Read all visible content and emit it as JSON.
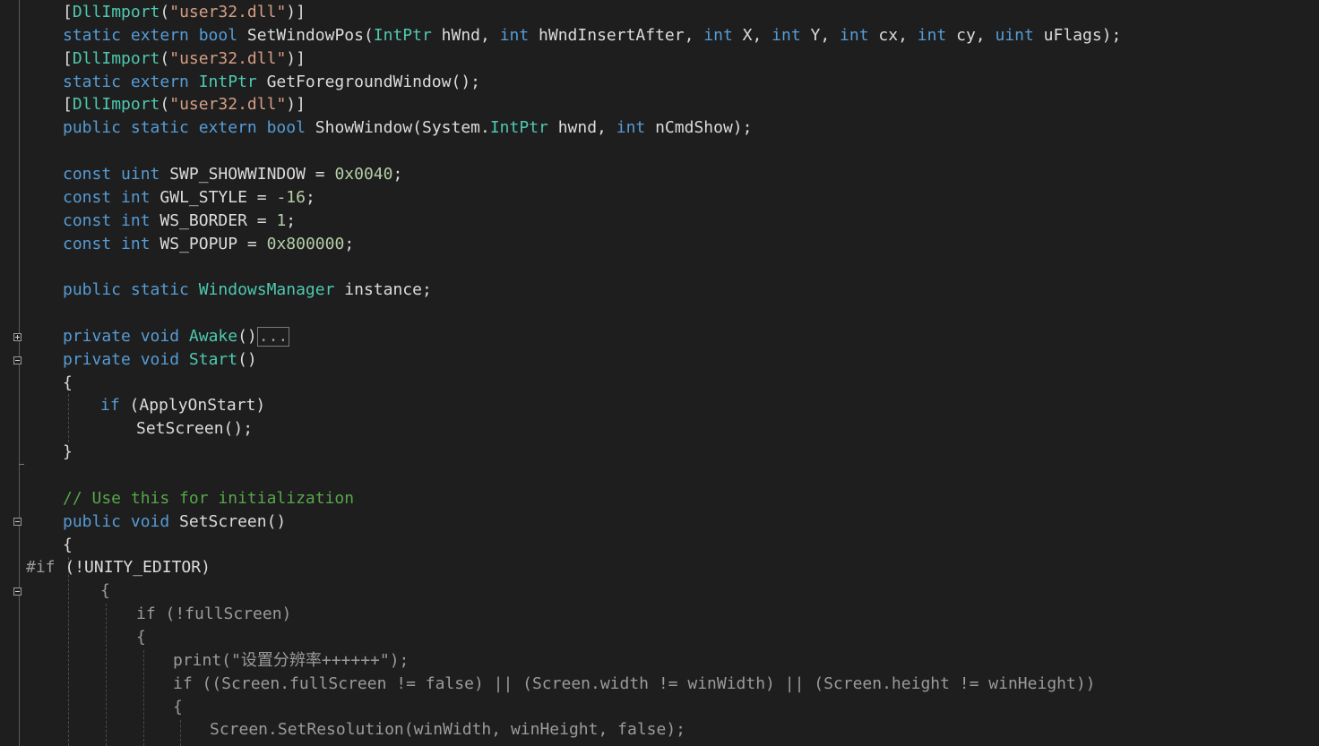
{
  "editor": {
    "lines": [
      {
        "indent": 70,
        "tokens": [
          {
            "t": "[",
            "c": "id"
          },
          {
            "t": "DllImport",
            "c": "ty"
          },
          {
            "t": "(",
            "c": "id"
          },
          {
            "t": "\"user32.dll\"",
            "c": "st"
          },
          {
            "t": ")]",
            "c": "id"
          }
        ]
      },
      {
        "indent": 70,
        "tokens": [
          {
            "t": "static ",
            "c": "kw"
          },
          {
            "t": "extern ",
            "c": "kw"
          },
          {
            "t": "bool ",
            "c": "kw"
          },
          {
            "t": "SetWindowPos",
            "c": "id"
          },
          {
            "t": "(",
            "c": "id"
          },
          {
            "t": "IntPtr ",
            "c": "ty"
          },
          {
            "t": "hWnd, ",
            "c": "id"
          },
          {
            "t": "int ",
            "c": "kw"
          },
          {
            "t": "hWndInsertAfter, ",
            "c": "id"
          },
          {
            "t": "int ",
            "c": "kw"
          },
          {
            "t": "X, ",
            "c": "id"
          },
          {
            "t": "int ",
            "c": "kw"
          },
          {
            "t": "Y, ",
            "c": "id"
          },
          {
            "t": "int ",
            "c": "kw"
          },
          {
            "t": "cx, ",
            "c": "id"
          },
          {
            "t": "int ",
            "c": "kw"
          },
          {
            "t": "cy, ",
            "c": "id"
          },
          {
            "t": "uint ",
            "c": "kw"
          },
          {
            "t": "uFlags);",
            "c": "id"
          }
        ]
      },
      {
        "indent": 70,
        "tokens": [
          {
            "t": "[",
            "c": "id"
          },
          {
            "t": "DllImport",
            "c": "ty"
          },
          {
            "t": "(",
            "c": "id"
          },
          {
            "t": "\"user32.dll\"",
            "c": "st"
          },
          {
            "t": ")]",
            "c": "id"
          }
        ]
      },
      {
        "indent": 70,
        "tokens": [
          {
            "t": "static ",
            "c": "kw"
          },
          {
            "t": "extern ",
            "c": "kw"
          },
          {
            "t": "IntPtr ",
            "c": "ty"
          },
          {
            "t": "GetForegroundWindow();",
            "c": "id"
          }
        ]
      },
      {
        "indent": 70,
        "tokens": [
          {
            "t": "[",
            "c": "id"
          },
          {
            "t": "DllImport",
            "c": "ty"
          },
          {
            "t": "(",
            "c": "id"
          },
          {
            "t": "\"user32.dll\"",
            "c": "st"
          },
          {
            "t": ")]",
            "c": "id"
          }
        ]
      },
      {
        "indent": 70,
        "tokens": [
          {
            "t": "public ",
            "c": "kw"
          },
          {
            "t": "static ",
            "c": "kw"
          },
          {
            "t": "extern ",
            "c": "kw"
          },
          {
            "t": "bool ",
            "c": "kw"
          },
          {
            "t": "ShowWindow",
            "c": "id"
          },
          {
            "t": "(System.",
            "c": "id"
          },
          {
            "t": "IntPtr ",
            "c": "ty"
          },
          {
            "t": "hwnd, ",
            "c": "id"
          },
          {
            "t": "int ",
            "c": "kw"
          },
          {
            "t": "nCmdShow);",
            "c": "id"
          }
        ]
      },
      {
        "indent": 70,
        "tokens": []
      },
      {
        "indent": 70,
        "tokens": [
          {
            "t": "const ",
            "c": "kw"
          },
          {
            "t": "uint ",
            "c": "kw"
          },
          {
            "t": "SWP_SHOWWINDOW = ",
            "c": "id"
          },
          {
            "t": "0x0040",
            "c": "nm"
          },
          {
            "t": ";",
            "c": "id"
          }
        ]
      },
      {
        "indent": 70,
        "tokens": [
          {
            "t": "const ",
            "c": "kw"
          },
          {
            "t": "int ",
            "c": "kw"
          },
          {
            "t": "GWL_STYLE = ",
            "c": "id"
          },
          {
            "t": "-16",
            "c": "nm"
          },
          {
            "t": ";",
            "c": "id"
          }
        ]
      },
      {
        "indent": 70,
        "tokens": [
          {
            "t": "const ",
            "c": "kw"
          },
          {
            "t": "int ",
            "c": "kw"
          },
          {
            "t": "WS_BORDER = ",
            "c": "id"
          },
          {
            "t": "1",
            "c": "nm"
          },
          {
            "t": ";",
            "c": "id"
          }
        ]
      },
      {
        "indent": 70,
        "tokens": [
          {
            "t": "const ",
            "c": "kw"
          },
          {
            "t": "int ",
            "c": "kw"
          },
          {
            "t": "WS_POPUP = ",
            "c": "id"
          },
          {
            "t": "0x800000",
            "c": "nm"
          },
          {
            "t": ";",
            "c": "id"
          }
        ]
      },
      {
        "indent": 70,
        "tokens": []
      },
      {
        "indent": 70,
        "tokens": [
          {
            "t": "public ",
            "c": "kw"
          },
          {
            "t": "static ",
            "c": "kw"
          },
          {
            "t": "WindowsManager ",
            "c": "ty"
          },
          {
            "t": "instance;",
            "c": "id"
          }
        ]
      },
      {
        "indent": 70,
        "tokens": []
      },
      {
        "indent": 70,
        "tokens": [
          {
            "t": "private ",
            "c": "kw"
          },
          {
            "t": "void ",
            "c": "kw"
          },
          {
            "t": "Awake",
            "c": "ty"
          },
          {
            "t": "()",
            "c": "id"
          },
          {
            "t": "...",
            "c": "box"
          }
        ]
      },
      {
        "indent": 70,
        "tokens": [
          {
            "t": "private ",
            "c": "kw"
          },
          {
            "t": "void ",
            "c": "kw"
          },
          {
            "t": "Start",
            "c": "ty"
          },
          {
            "t": "()",
            "c": "id"
          }
        ]
      },
      {
        "indent": 70,
        "tokens": [
          {
            "t": "{",
            "c": "id"
          }
        ]
      },
      {
        "indent": 112,
        "tokens": [
          {
            "t": "if ",
            "c": "kw"
          },
          {
            "t": "(ApplyOnStart)",
            "c": "id"
          }
        ]
      },
      {
        "indent": 152,
        "tokens": [
          {
            "t": "SetScreen();",
            "c": "id"
          }
        ]
      },
      {
        "indent": 70,
        "tokens": [
          {
            "t": "}",
            "c": "id"
          }
        ]
      },
      {
        "indent": 70,
        "tokens": []
      },
      {
        "indent": 70,
        "tokens": [
          {
            "t": "// Use this for initialization",
            "c": "cm"
          }
        ]
      },
      {
        "indent": 70,
        "tokens": [
          {
            "t": "public ",
            "c": "kw"
          },
          {
            "t": "void ",
            "c": "kw"
          },
          {
            "t": "SetScreen()",
            "c": "id"
          }
        ]
      },
      {
        "indent": 70,
        "tokens": [
          {
            "t": "{",
            "c": "id"
          }
        ]
      },
      {
        "indent": 29,
        "tokens": [
          {
            "t": "#if ",
            "c": "pp"
          },
          {
            "t": "(!UNITY_EDITOR)",
            "c": "id"
          }
        ]
      },
      {
        "indent": 112,
        "tokens": [
          {
            "t": "{",
            "c": "pp"
          }
        ]
      },
      {
        "indent": 152,
        "tokens": [
          {
            "t": "if (!fullScreen)",
            "c": "pp"
          }
        ]
      },
      {
        "indent": 152,
        "tokens": [
          {
            "t": "{",
            "c": "pp"
          }
        ]
      },
      {
        "indent": 193,
        "tokens": [
          {
            "t": "print(\"设置分辨率++++++\");",
            "c": "pp"
          }
        ]
      },
      {
        "indent": 193,
        "tokens": [
          {
            "t": "if ((Screen.fullScreen != false) || (Screen.width != winWidth) || (Screen.height != winHeight))",
            "c": "pp"
          }
        ]
      },
      {
        "indent": 193,
        "tokens": [
          {
            "t": "{",
            "c": "pp"
          }
        ]
      },
      {
        "indent": 234,
        "tokens": [
          {
            "t": "Screen.SetResolution(winWidth, winHeight, false);",
            "c": "pp"
          }
        ]
      }
    ]
  }
}
